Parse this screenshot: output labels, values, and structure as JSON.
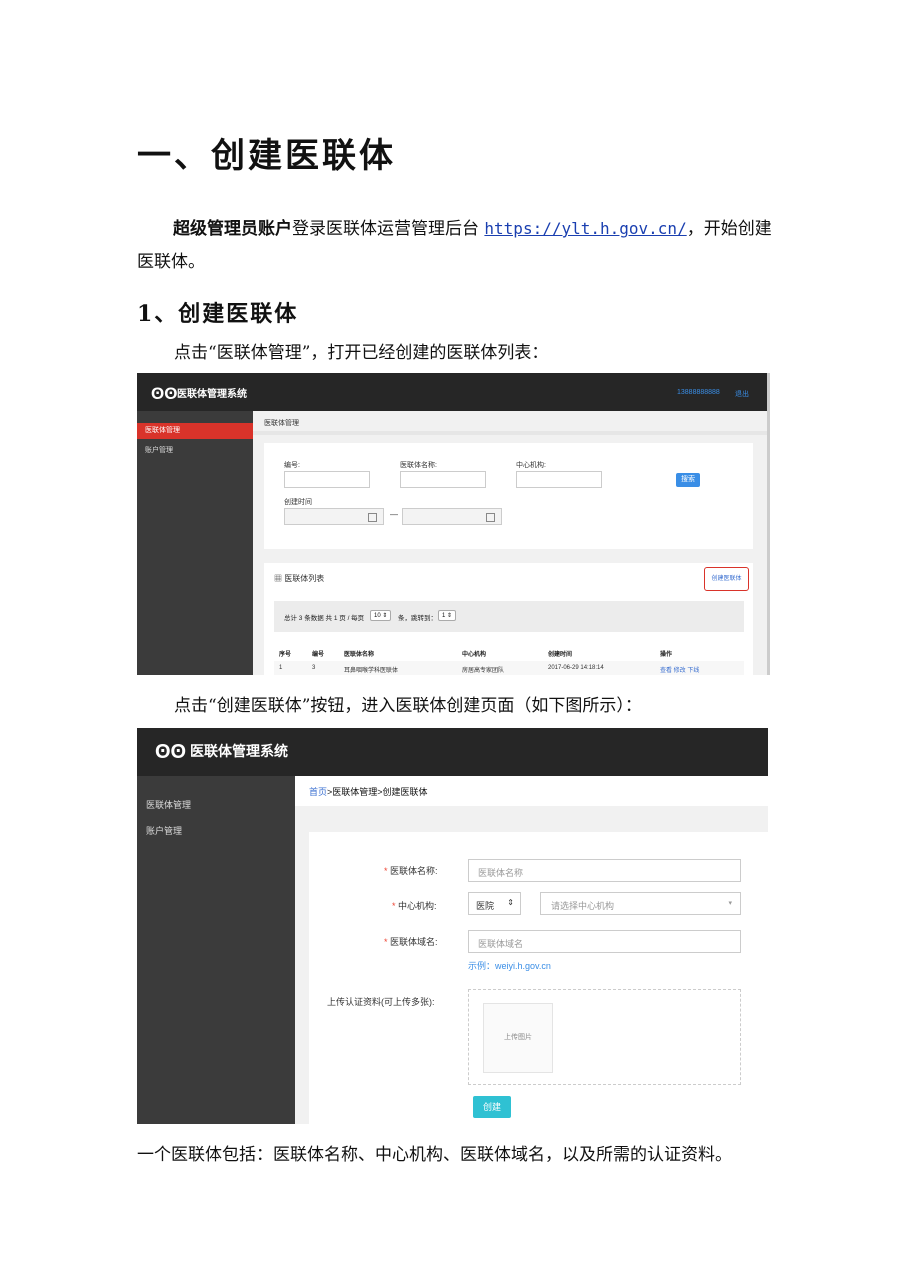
{
  "doc": {
    "h1": "一、创建医联体",
    "intro_bold": "超级管理员账户",
    "intro_text1": "登录医联体运营管理后台",
    "intro_link": "https://ylt.h.gov.cn/",
    "intro_text2": "，开始创建医联体。",
    "h2": "1、创建医联体",
    "caption1": "点击“医联体管理”，打开已经创建的医联体列表：",
    "caption2": "点击“创建医联体”按钮，进入医联体创建页面（如下图所示）：",
    "summary": "一个医联体包括：医联体名称、中心机构、医联体域名，以及所需的认证资料。"
  },
  "shot1": {
    "app_title": "医联体管理系统",
    "user_phone": "13888888888",
    "logout": "退出",
    "sidebar": [
      "医联体管理",
      "账户管理"
    ],
    "breadcrumb": "医联体管理",
    "filters": {
      "code_label": "编号:",
      "name_label": "医联体名称:",
      "center_label": "中心机构:",
      "time_label": "创建时间",
      "range_sep": "—"
    },
    "search_button": "搜索",
    "list_title": "医联体列表",
    "create_button": "创建医联体",
    "pager": {
      "prefix": "总计 3 条数据 共 1 页 / 每页",
      "per_page": "10 ⇕",
      "middle": "条，跳转到：",
      "jump": "1 ⇕"
    },
    "table": {
      "headers": [
        "序号",
        "编号",
        "医联体名称",
        "中心机构",
        "创建时间",
        "操作"
      ],
      "row": [
        "1",
        "3",
        "耳鼻咽喉学科医联体",
        "房居高专家团队",
        "2017-06-29 14:18:14"
      ],
      "actions": "查看 修改 下线"
    }
  },
  "shot2": {
    "app_title": "医联体管理系统",
    "sidebar": [
      "医联体管理",
      "账户管理"
    ],
    "breadcrumb_home": "首页",
    "breadcrumb_rest": ">医联体管理>创建医联体",
    "form": {
      "name_label": "医联体名称:",
      "name_placeholder": "医联体名称",
      "center_label": "中心机构:",
      "center_type": "医院",
      "center_placeholder": "请选择中心机构",
      "domain_label": "医联体域名:",
      "domain_placeholder": "医联体域名",
      "domain_example": "示例：weiyi.h.gov.cn",
      "upload_label": "上传认证资料(可上传多张):",
      "upload_text": "上传图片",
      "submit": "创建",
      "required_mark": "*"
    }
  },
  "colors": {
    "accent_red": "#d9332a",
    "button_blue": "#3a8ee6",
    "button_teal": "#2fc1d3",
    "topbar": "#262626",
    "sidebar": "#3b3b3b"
  }
}
